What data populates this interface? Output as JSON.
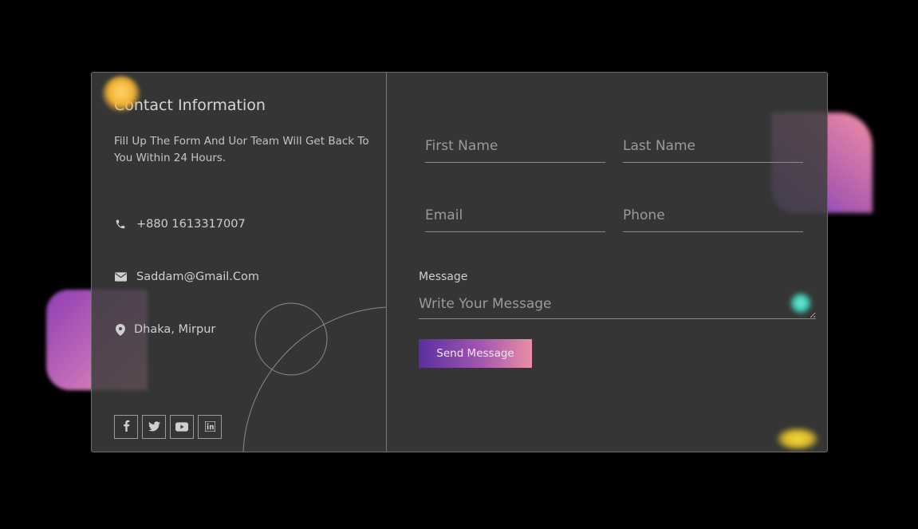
{
  "contact": {
    "title": "Contact Information",
    "subtitle": "Fill Up The Form And Uor Team Will Get Back To You Within 24 Hours.",
    "items": [
      {
        "icon": "phone-icon",
        "text": "+880 1613317007"
      },
      {
        "icon": "envelope-icon",
        "text": "Saddam@Gmail.Com"
      },
      {
        "icon": "map-pin-icon",
        "text": "Dhaka, Mirpur"
      }
    ],
    "socials": [
      {
        "icon": "facebook-icon"
      },
      {
        "icon": "twitter-icon"
      },
      {
        "icon": "youtube-icon"
      },
      {
        "icon": "linkedin-icon"
      }
    ]
  },
  "form": {
    "first_name": {
      "placeholder": "First Name",
      "value": ""
    },
    "last_name": {
      "placeholder": "Last Name",
      "value": ""
    },
    "email": {
      "placeholder": "Email",
      "value": ""
    },
    "phone": {
      "placeholder": "Phone",
      "value": ""
    },
    "message_label": "Message",
    "message": {
      "placeholder": "Write Your Message",
      "value": ""
    },
    "send_label": "Send Message"
  },
  "colors": {
    "background": "#000000",
    "card": "#3a3a3a",
    "button_gradient_start": "#5a2fa0",
    "button_gradient_end": "#ea8ea6",
    "blob_purple": "#8e3fb5",
    "blob_pink": "#e996b0",
    "orb_gold": "#f3b234",
    "orb_teal": "#3cc7b1"
  }
}
